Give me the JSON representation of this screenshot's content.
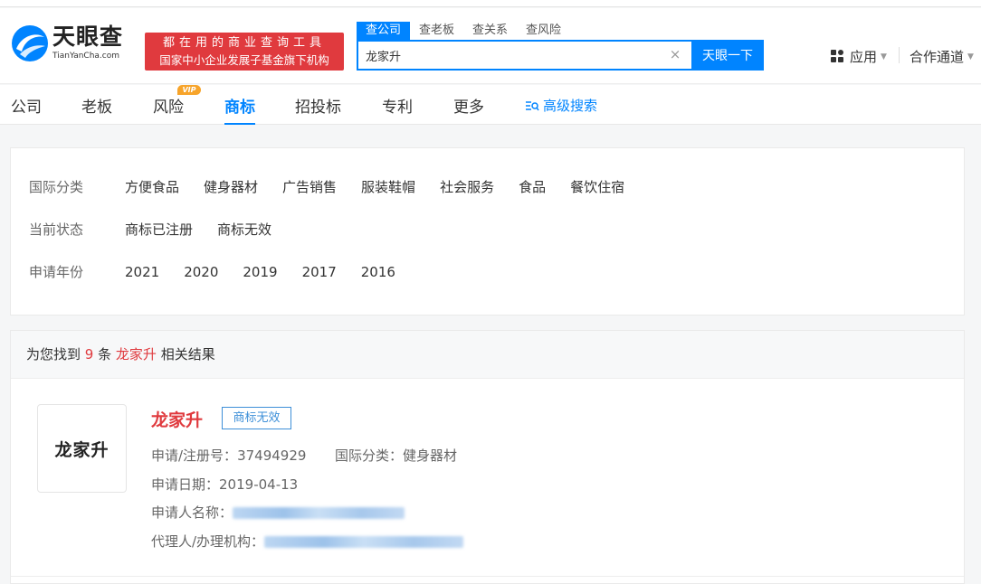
{
  "header": {
    "logo_cn": "天眼查",
    "logo_en": "TianYanCha.com",
    "promo_line1": "都在用的商业查询工具",
    "promo_line2": "国家中小企业发展子基金旗下机构",
    "search_tabs": [
      "查公司",
      "查老板",
      "查关系",
      "查风险"
    ],
    "search_value": "龙家升",
    "clear_glyph": "×",
    "search_button": "天眼一下",
    "apps_label": "应用",
    "coop_label": "合作通道"
  },
  "nav": {
    "items": [
      "公司",
      "老板",
      "风险",
      "商标",
      "招投标",
      "专利",
      "更多"
    ],
    "vip_badge": "VIP",
    "advanced_search": "高级搜索"
  },
  "filters": {
    "rows": [
      {
        "label": "国际分类",
        "options": [
          "方便食品",
          "健身器材",
          "广告销售",
          "服装鞋帽",
          "社会服务",
          "食品",
          "餐饮住宿"
        ]
      },
      {
        "label": "当前状态",
        "options": [
          "商标已注册",
          "商标无效"
        ]
      },
      {
        "label": "申请年份",
        "options": [
          "2021",
          "2020",
          "2019",
          "2017",
          "2016"
        ]
      }
    ]
  },
  "results": {
    "prefix": "为您找到",
    "count": "9",
    "unit": "条",
    "keyword": "龙家升",
    "suffix": "相关结果",
    "items": [
      {
        "logo_text": "龙家升",
        "title": "龙家升",
        "status": "商标无效",
        "reg_no_label": "申请/注册号：",
        "reg_no": "37494929",
        "class_label": "国际分类：",
        "class_value": "健身器材",
        "date_label": "申请日期：",
        "date": "2019-04-13",
        "applicant_label": "申请人名称：",
        "agent_label": "代理人/办理机构："
      }
    ]
  },
  "colors": {
    "brand_blue": "#0084ff",
    "highlight_red": "#e03a3e",
    "vip_orange": "#f7a42a"
  }
}
